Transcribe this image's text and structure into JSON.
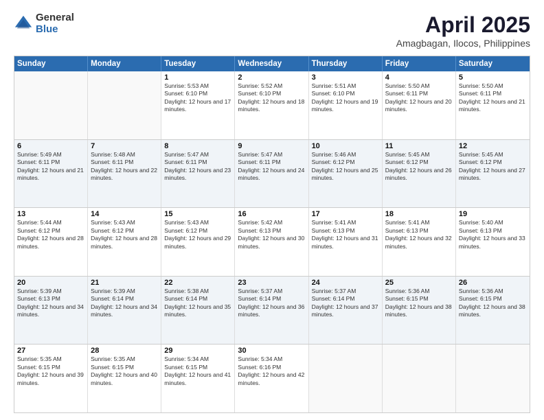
{
  "logo": {
    "general": "General",
    "blue": "Blue"
  },
  "title": "April 2025",
  "location": "Amagbagan, Ilocos, Philippines",
  "days_of_week": [
    "Sunday",
    "Monday",
    "Tuesday",
    "Wednesday",
    "Thursday",
    "Friday",
    "Saturday"
  ],
  "weeks": [
    [
      {
        "day": "",
        "info": ""
      },
      {
        "day": "",
        "info": ""
      },
      {
        "day": "1",
        "info": "Sunrise: 5:53 AM\nSunset: 6:10 PM\nDaylight: 12 hours and 17 minutes."
      },
      {
        "day": "2",
        "info": "Sunrise: 5:52 AM\nSunset: 6:10 PM\nDaylight: 12 hours and 18 minutes."
      },
      {
        "day": "3",
        "info": "Sunrise: 5:51 AM\nSunset: 6:10 PM\nDaylight: 12 hours and 19 minutes."
      },
      {
        "day": "4",
        "info": "Sunrise: 5:50 AM\nSunset: 6:11 PM\nDaylight: 12 hours and 20 minutes."
      },
      {
        "day": "5",
        "info": "Sunrise: 5:50 AM\nSunset: 6:11 PM\nDaylight: 12 hours and 21 minutes."
      }
    ],
    [
      {
        "day": "6",
        "info": "Sunrise: 5:49 AM\nSunset: 6:11 PM\nDaylight: 12 hours and 21 minutes."
      },
      {
        "day": "7",
        "info": "Sunrise: 5:48 AM\nSunset: 6:11 PM\nDaylight: 12 hours and 22 minutes."
      },
      {
        "day": "8",
        "info": "Sunrise: 5:47 AM\nSunset: 6:11 PM\nDaylight: 12 hours and 23 minutes."
      },
      {
        "day": "9",
        "info": "Sunrise: 5:47 AM\nSunset: 6:11 PM\nDaylight: 12 hours and 24 minutes."
      },
      {
        "day": "10",
        "info": "Sunrise: 5:46 AM\nSunset: 6:12 PM\nDaylight: 12 hours and 25 minutes."
      },
      {
        "day": "11",
        "info": "Sunrise: 5:45 AM\nSunset: 6:12 PM\nDaylight: 12 hours and 26 minutes."
      },
      {
        "day": "12",
        "info": "Sunrise: 5:45 AM\nSunset: 6:12 PM\nDaylight: 12 hours and 27 minutes."
      }
    ],
    [
      {
        "day": "13",
        "info": "Sunrise: 5:44 AM\nSunset: 6:12 PM\nDaylight: 12 hours and 28 minutes."
      },
      {
        "day": "14",
        "info": "Sunrise: 5:43 AM\nSunset: 6:12 PM\nDaylight: 12 hours and 28 minutes."
      },
      {
        "day": "15",
        "info": "Sunrise: 5:43 AM\nSunset: 6:12 PM\nDaylight: 12 hours and 29 minutes."
      },
      {
        "day": "16",
        "info": "Sunrise: 5:42 AM\nSunset: 6:13 PM\nDaylight: 12 hours and 30 minutes."
      },
      {
        "day": "17",
        "info": "Sunrise: 5:41 AM\nSunset: 6:13 PM\nDaylight: 12 hours and 31 minutes."
      },
      {
        "day": "18",
        "info": "Sunrise: 5:41 AM\nSunset: 6:13 PM\nDaylight: 12 hours and 32 minutes."
      },
      {
        "day": "19",
        "info": "Sunrise: 5:40 AM\nSunset: 6:13 PM\nDaylight: 12 hours and 33 minutes."
      }
    ],
    [
      {
        "day": "20",
        "info": "Sunrise: 5:39 AM\nSunset: 6:13 PM\nDaylight: 12 hours and 34 minutes."
      },
      {
        "day": "21",
        "info": "Sunrise: 5:39 AM\nSunset: 6:14 PM\nDaylight: 12 hours and 34 minutes."
      },
      {
        "day": "22",
        "info": "Sunrise: 5:38 AM\nSunset: 6:14 PM\nDaylight: 12 hours and 35 minutes."
      },
      {
        "day": "23",
        "info": "Sunrise: 5:37 AM\nSunset: 6:14 PM\nDaylight: 12 hours and 36 minutes."
      },
      {
        "day": "24",
        "info": "Sunrise: 5:37 AM\nSunset: 6:14 PM\nDaylight: 12 hours and 37 minutes."
      },
      {
        "day": "25",
        "info": "Sunrise: 5:36 AM\nSunset: 6:15 PM\nDaylight: 12 hours and 38 minutes."
      },
      {
        "day": "26",
        "info": "Sunrise: 5:36 AM\nSunset: 6:15 PM\nDaylight: 12 hours and 38 minutes."
      }
    ],
    [
      {
        "day": "27",
        "info": "Sunrise: 5:35 AM\nSunset: 6:15 PM\nDaylight: 12 hours and 39 minutes."
      },
      {
        "day": "28",
        "info": "Sunrise: 5:35 AM\nSunset: 6:15 PM\nDaylight: 12 hours and 40 minutes."
      },
      {
        "day": "29",
        "info": "Sunrise: 5:34 AM\nSunset: 6:15 PM\nDaylight: 12 hours and 41 minutes."
      },
      {
        "day": "30",
        "info": "Sunrise: 5:34 AM\nSunset: 6:16 PM\nDaylight: 12 hours and 42 minutes."
      },
      {
        "day": "",
        "info": ""
      },
      {
        "day": "",
        "info": ""
      },
      {
        "day": "",
        "info": ""
      }
    ]
  ]
}
